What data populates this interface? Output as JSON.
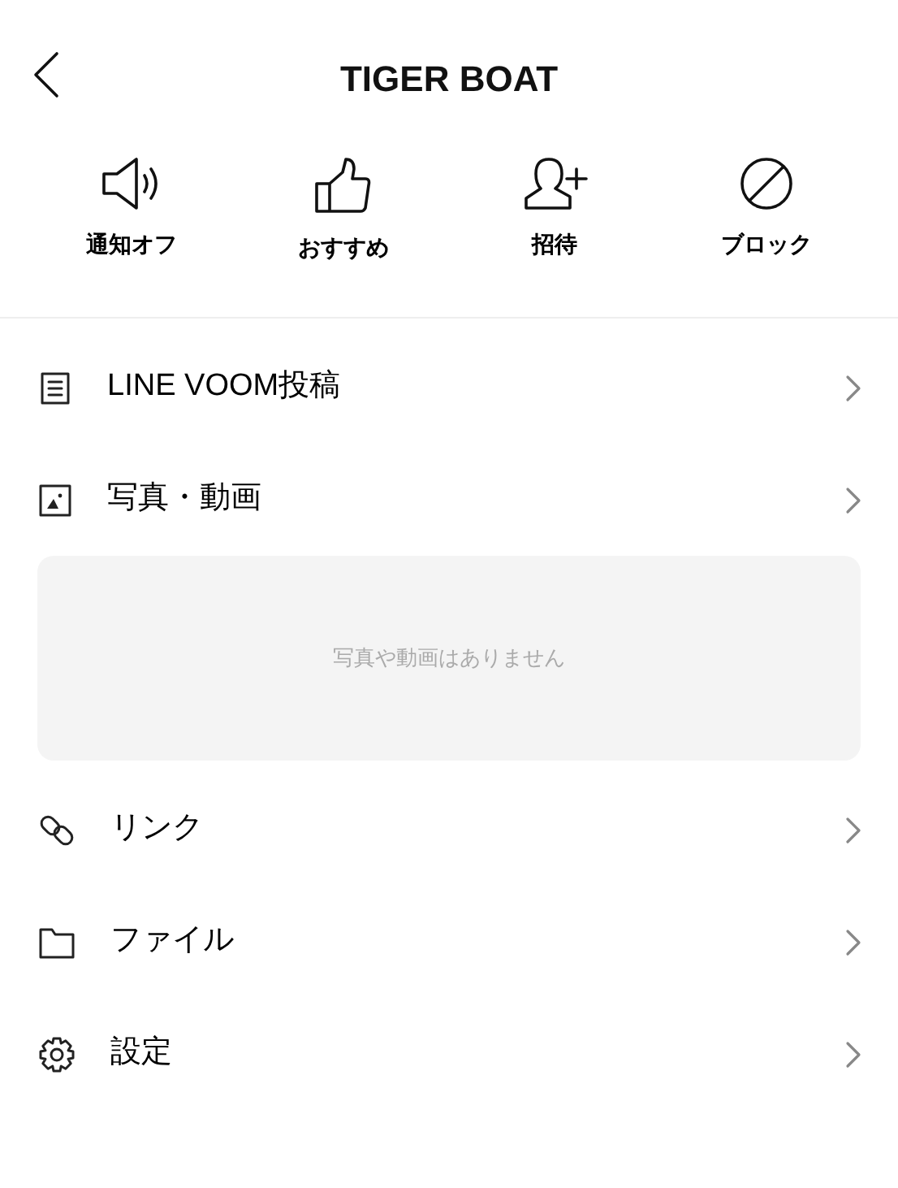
{
  "header": {
    "title": "TIGER BOAT"
  },
  "actions": [
    {
      "label": "通知オフ"
    },
    {
      "label": "おすすめ"
    },
    {
      "label": "招待"
    },
    {
      "label": "ブロック"
    }
  ],
  "menu": [
    {
      "label": "LINE VOOM投稿"
    },
    {
      "label": "写真・動画",
      "empty_message": "写真や動画はありません"
    },
    {
      "label": "リンク"
    },
    {
      "label": "ファイル"
    },
    {
      "label": "設定"
    }
  ]
}
